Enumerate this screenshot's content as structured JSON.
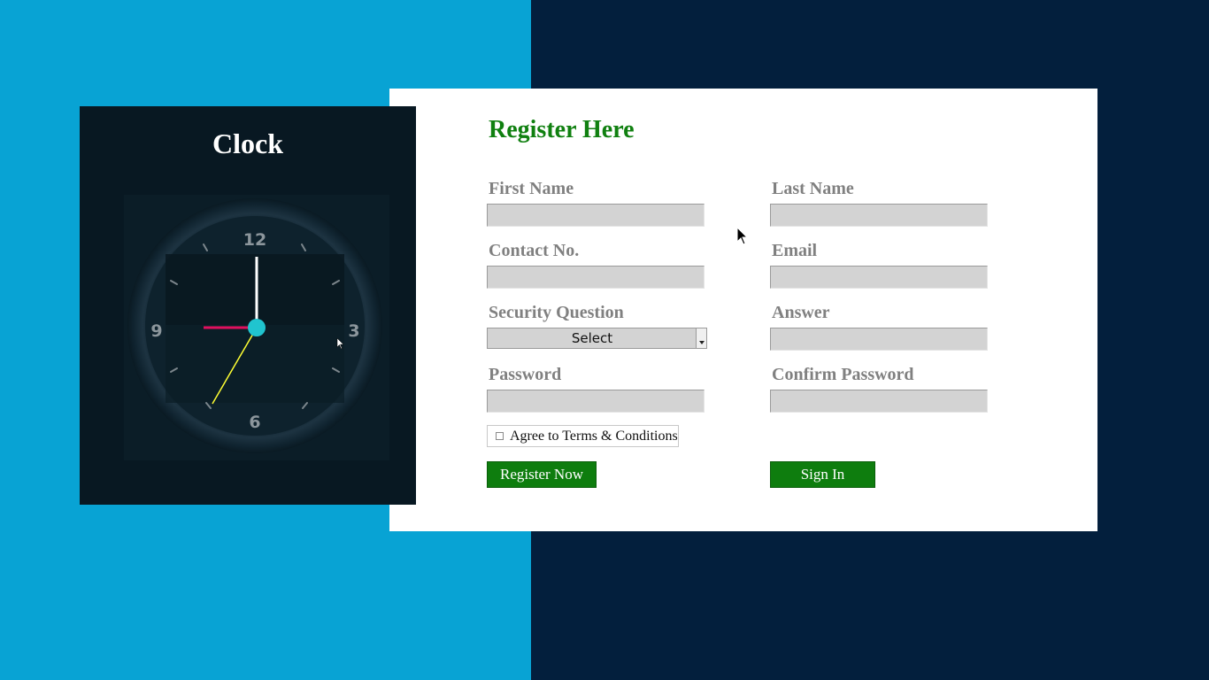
{
  "clock": {
    "title": "Clock",
    "numerals": [
      "12",
      "3",
      "6",
      "9"
    ],
    "colors": {
      "hour_hand": "#e0105e",
      "minute_hand": "#ffffff",
      "second_hand": "#ffff33",
      "center_dot": "#20c4cf"
    }
  },
  "register": {
    "title": "Register Here",
    "fields": {
      "first_name": {
        "label": "First Name",
        "value": ""
      },
      "last_name": {
        "label": "Last Name",
        "value": ""
      },
      "contact": {
        "label": "Contact No.",
        "value": ""
      },
      "email": {
        "label": "Email",
        "value": ""
      },
      "security_question": {
        "label": "Security Question",
        "selected": "Select"
      },
      "answer": {
        "label": "Answer",
        "value": ""
      },
      "password": {
        "label": "Password",
        "value": ""
      },
      "confirm_password": {
        "label": "Confirm Password",
        "value": ""
      }
    },
    "agree_label": "Agree to Terms & Conditions",
    "register_button": "Register Now",
    "signin_button": "Sign In",
    "colors": {
      "title": "#108010",
      "button": "#0e7d0e",
      "label": "#808080",
      "input": "#d3d3d3"
    }
  },
  "background": {
    "left": "#08a3d4",
    "right": "#031f3d"
  }
}
